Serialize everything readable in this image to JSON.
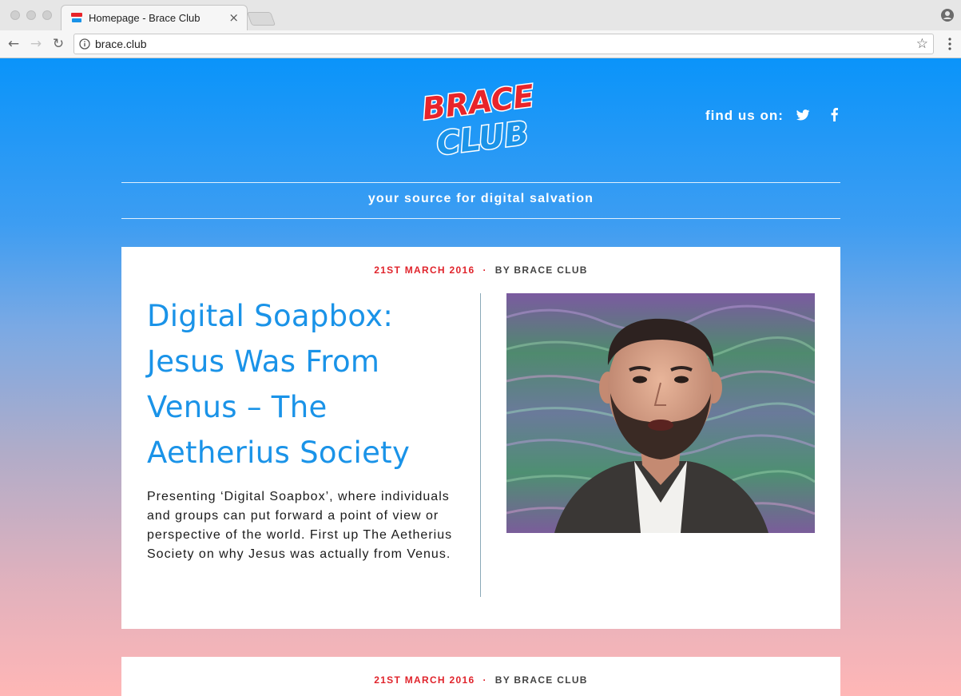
{
  "browser": {
    "tab_title": "Homepage - Brace Club",
    "tab_close": "×",
    "url": "brace.club",
    "back_icon": "←",
    "forward_icon": "→",
    "reload_icon": "↻",
    "star_icon": "☆"
  },
  "header": {
    "logo_text_top": "BRACE",
    "logo_text_bottom": "CLUB",
    "find_us_label": "find us on:",
    "social": [
      "twitter-icon",
      "facebook-icon"
    ],
    "tagline": "your source for digital salvation"
  },
  "posts": [
    {
      "date": "21ST MARCH 2016",
      "separator": "·",
      "author": "BY BRACE CLUB",
      "title": "Digital Soapbox: Jesus Was From Venus – The Aetherius Society",
      "excerpt": "Presenting ‘Digital Soapbox’, where individuals and groups can put forward a point of view or perspective of the world. First up The Aetherius Society on why Jesus was actually from Venus."
    },
    {
      "date": "21ST MARCH 2016",
      "separator": "·",
      "author": "BY BRACE CLUB"
    }
  ],
  "colors": {
    "accent_blue": "#1a93e8",
    "date_red": "#e0232b",
    "logo_red": "#e8242a",
    "gradient_top": "#0a94fa",
    "gradient_bottom": "#ffb6b6"
  }
}
